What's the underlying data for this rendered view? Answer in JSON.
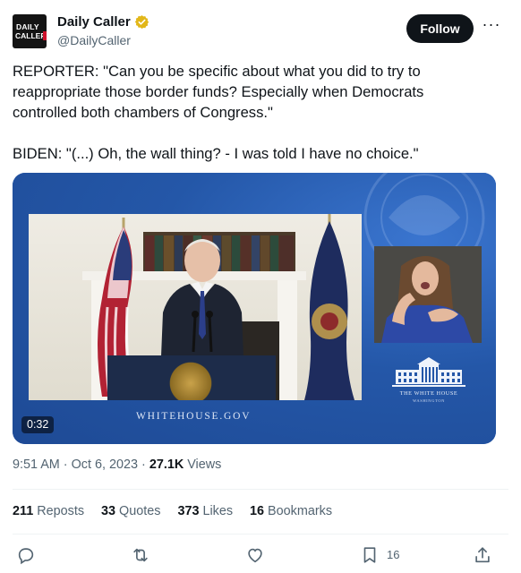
{
  "author": {
    "name": "Daily Caller",
    "handle": "@DailyCaller",
    "avatar_text_line1": "DAILY",
    "avatar_text_line2": "CALLER"
  },
  "follow_label": "Follow",
  "more_label": "···",
  "tweet_lines": [
    "REPORTER: \"Can you be specific about what you did to try to",
    "reappropriate those border funds? Especially when Democrats",
    "controlled both chambers of Congress.\"",
    "BIDEN: \"(...) Oh, the wall thing? - I was told I have no choice.\""
  ],
  "media": {
    "duration": "0:32",
    "watermark_left": "WHITEHOUSE.GOV",
    "logo_text": "THE WHITE HOUSE",
    "logo_subtext": "WASHINGTON"
  },
  "meta": {
    "time": "9:51 AM",
    "separator": " · ",
    "date": "Oct 6, 2023",
    "views_count": "27.1K",
    "views_label": " Views"
  },
  "stats": {
    "reposts_count": "211",
    "reposts_label": " Reposts",
    "quotes_count": "33",
    "quotes_label": " Quotes",
    "likes_count": "373",
    "likes_label": " Likes",
    "bookmarks_count": "16",
    "bookmarks_label": " Bookmarks"
  },
  "actions": {
    "reply_icon": "reply-icon",
    "repost_icon": "repost-icon",
    "like_icon": "heart-icon",
    "bookmark_icon": "bookmark-icon",
    "bookmark_count": "16",
    "share_icon": "share-icon"
  },
  "colors": {
    "verified_gold": "#e2b719",
    "follow_bg": "#0f1419",
    "secondary_text": "#536471",
    "media_blue": "#2457a8"
  }
}
